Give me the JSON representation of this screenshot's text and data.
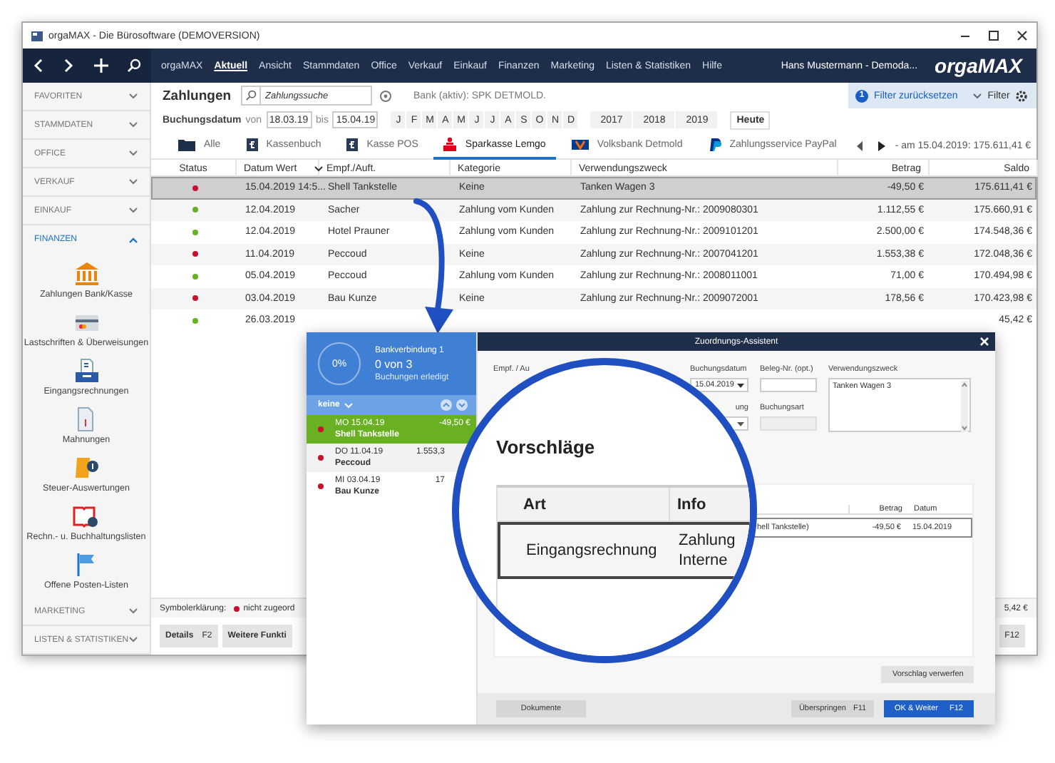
{
  "window": {
    "title": "orgaMAX - Die Bürosoftware (DEMOVERSION)"
  },
  "nav": {
    "menu": [
      {
        "label": "orgaMAX",
        "selected": false
      },
      {
        "label": "Aktuell",
        "selected": true
      },
      {
        "label": "Ansicht",
        "selected": false
      },
      {
        "label": "Stammdaten",
        "selected": false
      },
      {
        "label": "Office",
        "selected": false
      },
      {
        "label": "Verkauf",
        "selected": false
      },
      {
        "label": "Einkauf",
        "selected": false
      },
      {
        "label": "Finanzen",
        "selected": false
      },
      {
        "label": "Marketing",
        "selected": false
      },
      {
        "label": "Listen & Statistiken",
        "selected": false
      },
      {
        "label": "Hilfe",
        "selected": false
      }
    ],
    "user": "Hans Mustermann - Demoda...",
    "logo": "orga**MAX**"
  },
  "sidebar": {
    "sections": [
      {
        "label": "FAVORITEN",
        "expanded": false
      },
      {
        "label": "STAMMDATEN",
        "expanded": false
      },
      {
        "label": "OFFICE",
        "expanded": false
      },
      {
        "label": "VERKAUF",
        "expanded": false
      },
      {
        "label": "EINKAUF",
        "expanded": false
      },
      {
        "label": "FINANZEN",
        "expanded": true,
        "items": [
          "Zahlungen Bank/Kasse",
          "Lastschriften & Überweisungen",
          "Eingangsrechnungen",
          "Mahnungen",
          "Steuer-Auswertungen",
          "Rechn.- u. Buchhaltungslisten",
          "Offene Posten-Listen"
        ]
      },
      {
        "label": "MARKETING",
        "expanded": false
      },
      {
        "label": "LISTEN & STATISTIKEN",
        "expanded": false
      }
    ]
  },
  "toolbar": {
    "title": "Zahlungen",
    "search": {
      "placeholder": "Zahlungssuche"
    },
    "bank": "Bank (aktiv): SPK DETMOLD.",
    "date_label": "Buchungsdatum",
    "from_label": "von",
    "from": "18.03.19",
    "to_label": "bis",
    "to": "15.04.19",
    "months": [
      "J",
      "F",
      "M",
      "A",
      "M",
      "J",
      "J",
      "A",
      "S",
      "O",
      "N",
      "D"
    ],
    "years": [
      "2017",
      "2018",
      "2019"
    ],
    "today": "Heute"
  },
  "filter": {
    "badge": "1",
    "reset": "Filter zurücksetzen",
    "label": "Filter"
  },
  "tabs": [
    {
      "label": "Alle",
      "selected": false
    },
    {
      "label": "Kassenbuch",
      "selected": false
    },
    {
      "label": "Kasse POS",
      "selected": false
    },
    {
      "label": "Sparkasse Lemgo",
      "selected": true
    },
    {
      "label": "Volksbank Detmold",
      "selected": false
    },
    {
      "label": "Zahlungsservice PayPal",
      "selected": false
    }
  ],
  "balance": "- am 15.04.2019: 175.611,41 €",
  "table": {
    "columns": [
      "Status",
      "Datum Wert",
      "Empf./Auft.",
      "Kategorie",
      "Verwendungszweck",
      "Betrag",
      "Saldo"
    ],
    "rows": [
      {
        "color": "#c8102e",
        "selected": true,
        "cells": [
          "",
          "15.04.2019 14:5...",
          "Shell Tankstelle",
          "Keine",
          "Tanken Wagen 3",
          "-49,50 €",
          "175.611,41 €"
        ]
      },
      {
        "color": "#6ab023",
        "selected": false,
        "cells": [
          "",
          "12.04.2019",
          "Sacher",
          "Zahlung vom Kunden",
          "Zahlung zur Rechnung-Nr.: 2009080301",
          "1.112,55 €",
          "175.660,91 €"
        ]
      },
      {
        "color": "#6ab023",
        "selected": false,
        "cells": [
          "",
          "12.04.2019",
          "Hotel Prauner",
          "Zahlung vom Kunden",
          "Zahlung zur Rechnung-Nr.: 2009101201",
          "2.500,00 €",
          "174.548,36 €"
        ]
      },
      {
        "color": "#c8102e",
        "selected": false,
        "cells": [
          "",
          "11.04.2019",
          "Peccoud",
          "Keine",
          "Zahlung zur Rechnung-Nr.: 2007041201",
          "1.553,38 €",
          "172.048,36 €"
        ]
      },
      {
        "color": "#6ab023",
        "selected": false,
        "cells": [
          "",
          "05.04.2019",
          "Peccoud",
          "Zahlung vom Kunden",
          "Zahlung zur Rechnung-Nr.: 2008011001",
          "71,00 €",
          "170.494,98 €"
        ]
      },
      {
        "color": "#c8102e",
        "selected": false,
        "cells": [
          "",
          "03.04.2019",
          "Bau Kunze",
          "Keine",
          "Zahlung zur Rechnung-Nr.: 2009072001",
          "178,56 €",
          "170.423,98 €"
        ]
      },
      {
        "color": "#6ab023",
        "selected": false,
        "cells": [
          "",
          "26.03.2019",
          "",
          "",
          "",
          "",
          "45,42 €"
        ]
      }
    ]
  },
  "legend": {
    "label": "Symbolerklärung:",
    "items": [
      {
        "color": "#c8102e",
        "label": "nicht zugeord"
      }
    ]
  },
  "summary": "5,42 €",
  "buttons": [
    {
      "label": "Details",
      "key": "F2"
    },
    {
      "label": "Weitere Funkti"
    },
    {
      "key": "F12"
    }
  ],
  "dialog": {
    "title": "Zuordnungs-Assistent",
    "progress": {
      "percent": "0%",
      "title": "Bankverbindung 1",
      "count": "0 von 3",
      "caption": "Buchungen erledigt"
    },
    "filter": "keine",
    "bookings": [
      {
        "day": "MO 15.04.19",
        "amount": "-49,50 €",
        "name": "Shell Tankstelle",
        "color": "#c8102e",
        "selected": true
      },
      {
        "day": "DO 11.04.19",
        "amount": "1.553,3",
        "name": "Peccoud",
        "color": "#c8102e",
        "selected": false
      },
      {
        "day": "MI 03.04.19",
        "amount": "17",
        "name": "Bau Kunze",
        "color": "#c8102e",
        "selected": false
      }
    ],
    "form": {
      "payee_label": "Empf. / Au",
      "date_label": "Buchungsdatum",
      "date": "15.04.2019",
      "second_label": "ung",
      "receipt_label": "Beleg-Nr. (opt.)",
      "type_label": "Buchungsart",
      "purpose_label": "Verwendungszweck",
      "purpose": "Tanken Wagen 3"
    },
    "matches": {
      "columns": [
        "Betrag",
        "Datum"
      ],
      "row": [
        "hell Tankstelle)",
        "-49,50 €",
        "15.04.2019"
      ]
    },
    "discard": "Vorschlag verwerfen",
    "documents": "Dokumente",
    "skip": {
      "label": "Überspringen",
      "key": "F11"
    },
    "ok": {
      "label": "OK & Weiter",
      "key": "F12"
    }
  },
  "magnifier": {
    "title": "Vorschläge",
    "columns": [
      "Art",
      "Info"
    ],
    "row": {
      "type": "Eingangsrechnung",
      "info": [
        "Zahlung",
        "Interne"
      ]
    }
  }
}
